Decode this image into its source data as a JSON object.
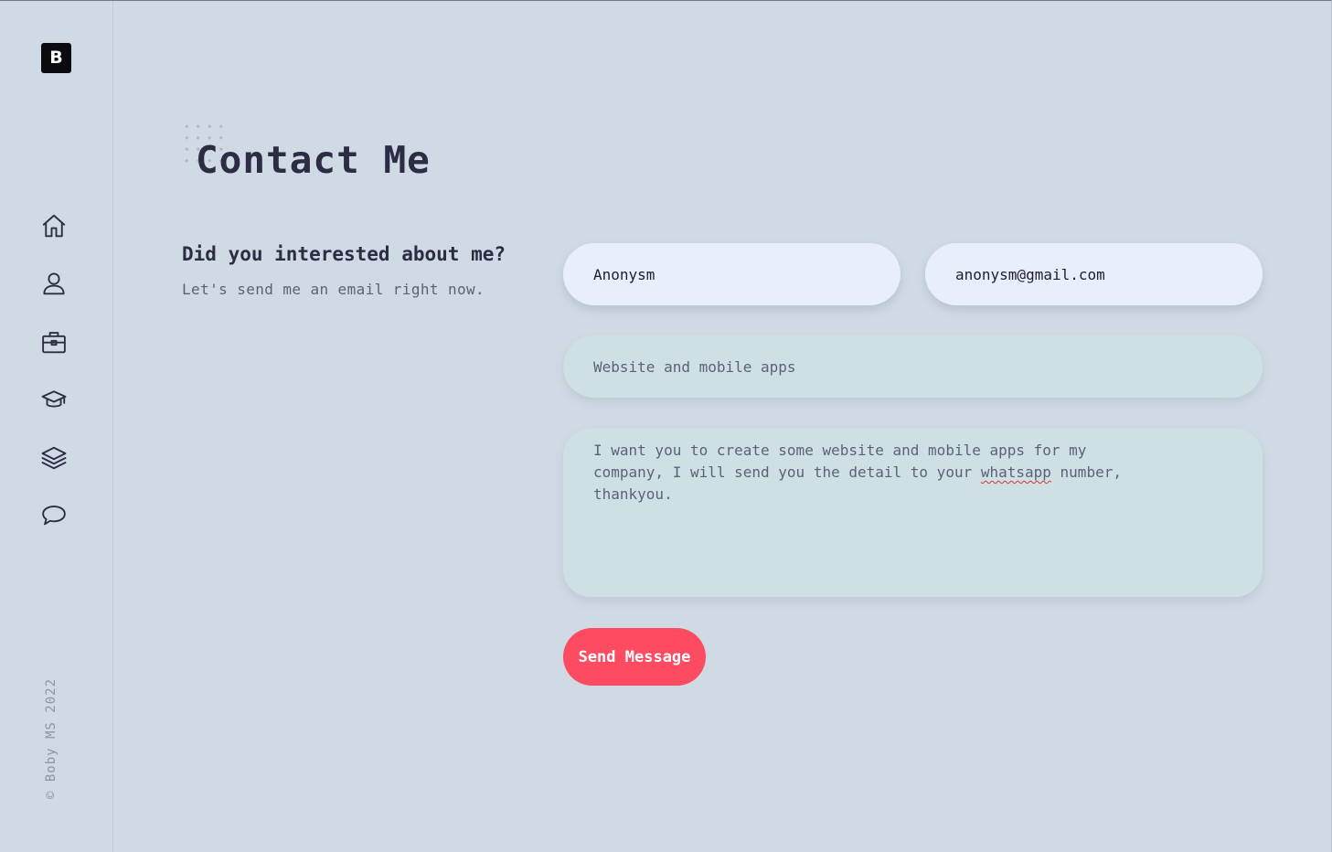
{
  "logo": {
    "letter": "B"
  },
  "sidebar": {
    "items": [
      {
        "icon": "home-icon",
        "name": "home"
      },
      {
        "icon": "user-icon",
        "name": "about"
      },
      {
        "icon": "briefcase-icon",
        "name": "work"
      },
      {
        "icon": "graduation-cap-icon",
        "name": "education"
      },
      {
        "icon": "layers-icon",
        "name": "portfolio"
      },
      {
        "icon": "chat-bubble-icon",
        "name": "contact"
      }
    ],
    "copyright": "© Boby MS 2022"
  },
  "page": {
    "title": "Contact Me",
    "intro_heading": "Did you interested about me?",
    "intro_sub": "Let's send me an email right now."
  },
  "form": {
    "name_value": "Anonysm",
    "email_value": "anonysm@gmail.com",
    "subject_value": "Website and mobile apps",
    "message_before": "I want you to create some website and mobile apps for my\ncompany, I will send you the detail to your ",
    "message_flagged_word": "whatsapp",
    "message_after": " number,\nthankyou.",
    "send_label": "Send Message"
  },
  "colors": {
    "background": "#d0dae4",
    "accent": "#fd4b62",
    "text": "#2d2c45"
  }
}
